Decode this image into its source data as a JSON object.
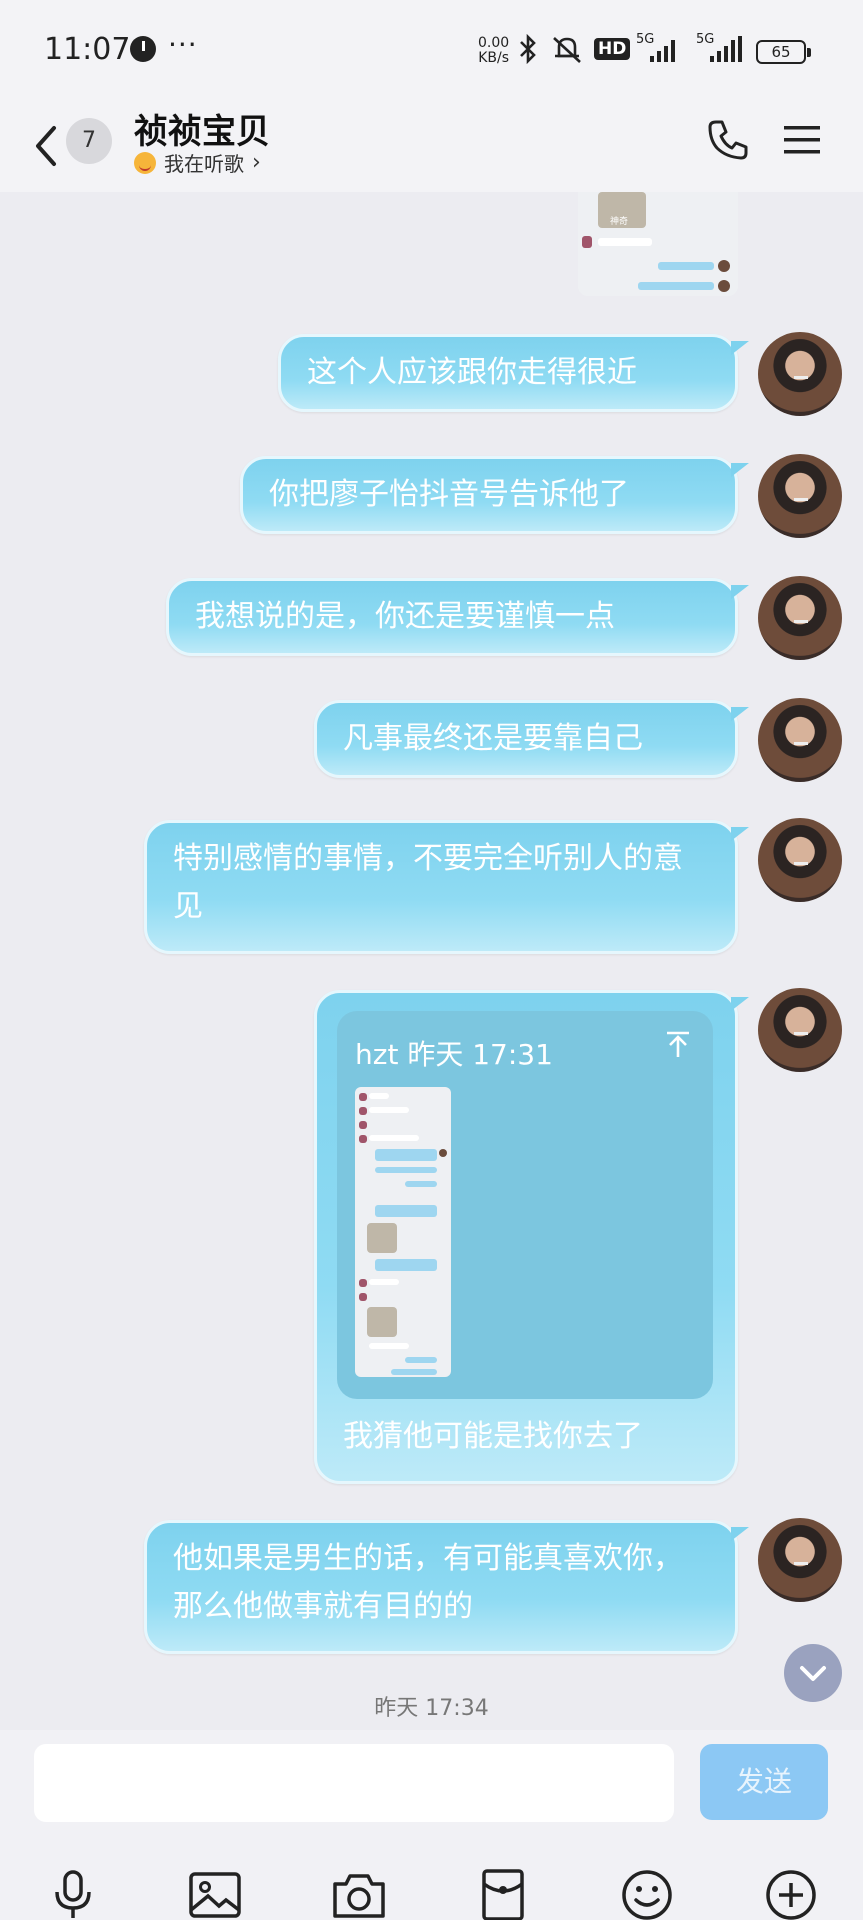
{
  "status_bar": {
    "time": "11:07",
    "more": "···",
    "net_speed_value": "0.00",
    "net_speed_unit": "KB/s",
    "hd_label": "HD",
    "signal1": "5G",
    "signal2": "5G",
    "battery": "65"
  },
  "header": {
    "unread_count": "7",
    "contact_name": "祯祯宝贝",
    "status_text": "我在听歌"
  },
  "messages": [
    {
      "text": "这个人应该跟你走得很近"
    },
    {
      "text": "你把廖子怡抖音号告诉他了"
    },
    {
      "text": "我想说的是，你还是要谨慎一点"
    },
    {
      "text": "凡事最终还是要靠自己"
    },
    {
      "text": "特别感情的事情，不要完全听别人的意见"
    },
    {
      "quote_header": "hzt 昨天 17:31",
      "text": "我猜他可能是找你去了"
    },
    {
      "text": "他如果是男生的话，有可能真喜欢你，那么他做事就有目的的"
    }
  ],
  "mini_top": {
    "thumb_label": "神奇"
  },
  "timestamp": "昨天 17:34",
  "input": {
    "placeholder": "",
    "send_label": "发送"
  },
  "colors": {
    "bubble": "#8fdbf3",
    "send": "#8cc8f4",
    "accent": "#7ed2ee"
  },
  "toolbar_icons": [
    "microphone-icon",
    "image-icon",
    "camera-icon",
    "red-packet-icon",
    "emoji-icon",
    "plus-icon"
  ]
}
